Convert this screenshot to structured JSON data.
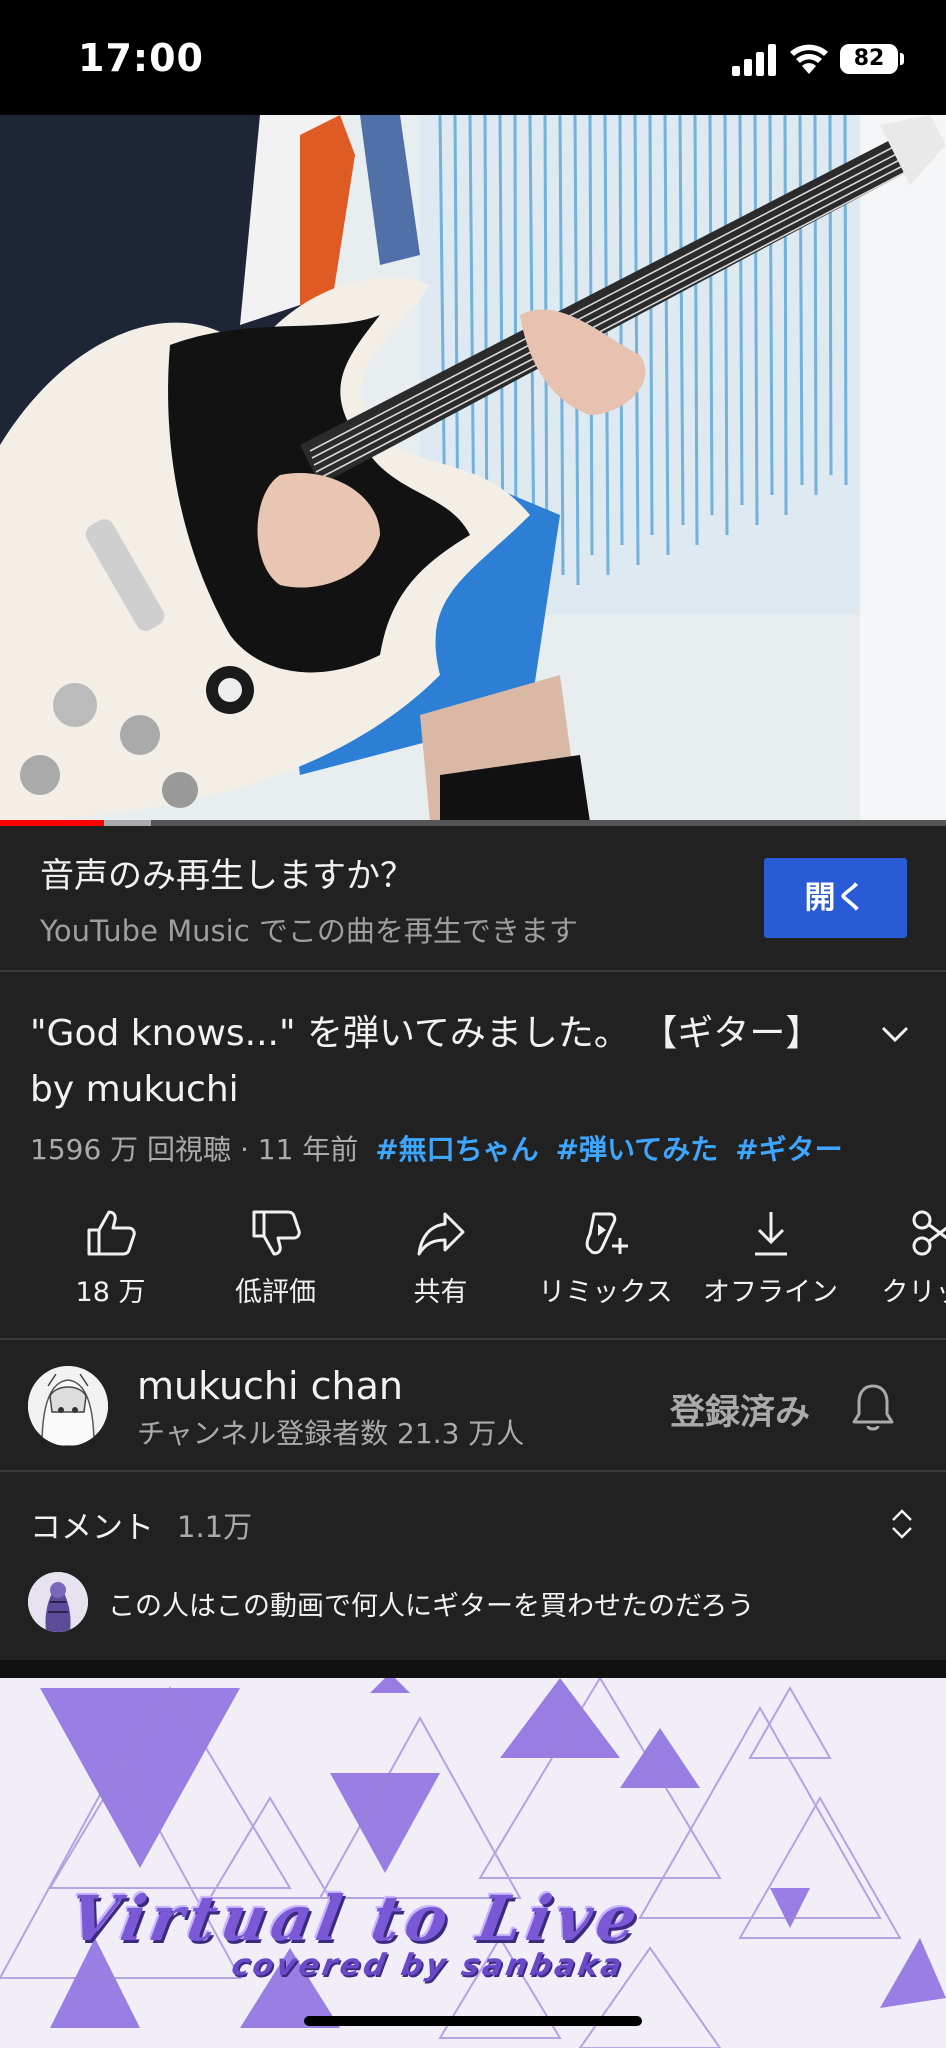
{
  "status_bar": {
    "time": "17:00",
    "battery": "82"
  },
  "player": {
    "progress": 0.11,
    "buffered": 0.16
  },
  "music_prompt": {
    "title": "音声のみ再生しますか？",
    "subtitle": "YouTube Music でこの曲を再生できます",
    "open_label": "開く"
  },
  "video": {
    "title": "\"God knows...\" を弾いてみました。 【ギター】 by mukuchi",
    "views": "1596 万 回視聴",
    "age": "11 年前",
    "hashtags": [
      "#無口ちゃん",
      "#弾いてみた",
      "#ギター"
    ]
  },
  "actions": {
    "like": "18 万",
    "dislike": "低評価",
    "share": "共有",
    "remix": "リミックス",
    "offline": "オフライン",
    "clip": "クリップ"
  },
  "channel": {
    "name": "mukuchi chan",
    "subscribers": "チャンネル登録者数 21.3 万人",
    "subscribed_label": "登録済み"
  },
  "comments": {
    "label": "コメント",
    "count": "1.1万",
    "top_comment": "この人はこの動画で何人にギターを買わせたのだろう"
  },
  "next_video": {
    "title": "Virtual to Live",
    "subtitle": "covered by sanbaka"
  },
  "colors": {
    "accent": "#2a5bd7",
    "link": "#3ea6ff",
    "progress": "#ff0000",
    "background": "#212121"
  }
}
